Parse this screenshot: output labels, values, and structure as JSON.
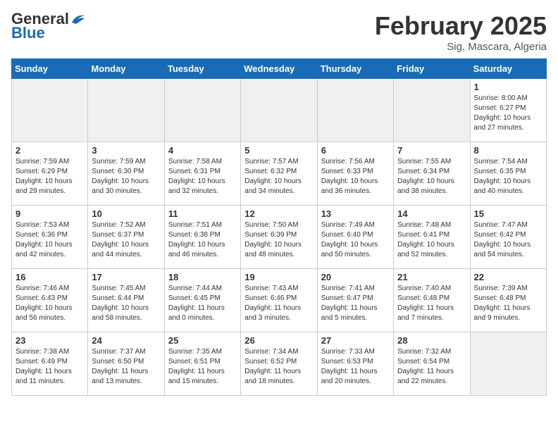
{
  "header": {
    "logo_line1": "General",
    "logo_line2": "Blue",
    "month": "February 2025",
    "location": "Sig, Mascara, Algeria"
  },
  "weekdays": [
    "Sunday",
    "Monday",
    "Tuesday",
    "Wednesday",
    "Thursday",
    "Friday",
    "Saturday"
  ],
  "weeks": [
    [
      {
        "day": "",
        "info": ""
      },
      {
        "day": "",
        "info": ""
      },
      {
        "day": "",
        "info": ""
      },
      {
        "day": "",
        "info": ""
      },
      {
        "day": "",
        "info": ""
      },
      {
        "day": "",
        "info": ""
      },
      {
        "day": "1",
        "info": "Sunrise: 8:00 AM\nSunset: 6:27 PM\nDaylight: 10 hours and 27 minutes."
      }
    ],
    [
      {
        "day": "2",
        "info": "Sunrise: 7:59 AM\nSunset: 6:29 PM\nDaylight: 10 hours and 29 minutes."
      },
      {
        "day": "3",
        "info": "Sunrise: 7:59 AM\nSunset: 6:30 PM\nDaylight: 10 hours and 30 minutes."
      },
      {
        "day": "4",
        "info": "Sunrise: 7:58 AM\nSunset: 6:31 PM\nDaylight: 10 hours and 32 minutes."
      },
      {
        "day": "5",
        "info": "Sunrise: 7:57 AM\nSunset: 6:32 PM\nDaylight: 10 hours and 34 minutes."
      },
      {
        "day": "6",
        "info": "Sunrise: 7:56 AM\nSunset: 6:33 PM\nDaylight: 10 hours and 36 minutes."
      },
      {
        "day": "7",
        "info": "Sunrise: 7:55 AM\nSunset: 6:34 PM\nDaylight: 10 hours and 38 minutes."
      },
      {
        "day": "8",
        "info": "Sunrise: 7:54 AM\nSunset: 6:35 PM\nDaylight: 10 hours and 40 minutes."
      }
    ],
    [
      {
        "day": "9",
        "info": "Sunrise: 7:53 AM\nSunset: 6:36 PM\nDaylight: 10 hours and 42 minutes."
      },
      {
        "day": "10",
        "info": "Sunrise: 7:52 AM\nSunset: 6:37 PM\nDaylight: 10 hours and 44 minutes."
      },
      {
        "day": "11",
        "info": "Sunrise: 7:51 AM\nSunset: 6:38 PM\nDaylight: 10 hours and 46 minutes."
      },
      {
        "day": "12",
        "info": "Sunrise: 7:50 AM\nSunset: 6:39 PM\nDaylight: 10 hours and 48 minutes."
      },
      {
        "day": "13",
        "info": "Sunrise: 7:49 AM\nSunset: 6:40 PM\nDaylight: 10 hours and 50 minutes."
      },
      {
        "day": "14",
        "info": "Sunrise: 7:48 AM\nSunset: 6:41 PM\nDaylight: 10 hours and 52 minutes."
      },
      {
        "day": "15",
        "info": "Sunrise: 7:47 AM\nSunset: 6:42 PM\nDaylight: 10 hours and 54 minutes."
      }
    ],
    [
      {
        "day": "16",
        "info": "Sunrise: 7:46 AM\nSunset: 6:43 PM\nDaylight: 10 hours and 56 minutes."
      },
      {
        "day": "17",
        "info": "Sunrise: 7:45 AM\nSunset: 6:44 PM\nDaylight: 10 hours and 58 minutes."
      },
      {
        "day": "18",
        "info": "Sunrise: 7:44 AM\nSunset: 6:45 PM\nDaylight: 11 hours and 0 minutes."
      },
      {
        "day": "19",
        "info": "Sunrise: 7:43 AM\nSunset: 6:46 PM\nDaylight: 11 hours and 3 minutes."
      },
      {
        "day": "20",
        "info": "Sunrise: 7:41 AM\nSunset: 6:47 PM\nDaylight: 11 hours and 5 minutes."
      },
      {
        "day": "21",
        "info": "Sunrise: 7:40 AM\nSunset: 6:48 PM\nDaylight: 11 hours and 7 minutes."
      },
      {
        "day": "22",
        "info": "Sunrise: 7:39 AM\nSunset: 6:48 PM\nDaylight: 11 hours and 9 minutes."
      }
    ],
    [
      {
        "day": "23",
        "info": "Sunrise: 7:38 AM\nSunset: 6:49 PM\nDaylight: 11 hours and 11 minutes."
      },
      {
        "day": "24",
        "info": "Sunrise: 7:37 AM\nSunset: 6:50 PM\nDaylight: 11 hours and 13 minutes."
      },
      {
        "day": "25",
        "info": "Sunrise: 7:35 AM\nSunset: 6:51 PM\nDaylight: 11 hours and 15 minutes."
      },
      {
        "day": "26",
        "info": "Sunrise: 7:34 AM\nSunset: 6:52 PM\nDaylight: 11 hours and 18 minutes."
      },
      {
        "day": "27",
        "info": "Sunrise: 7:33 AM\nSunset: 6:53 PM\nDaylight: 11 hours and 20 minutes."
      },
      {
        "day": "28",
        "info": "Sunrise: 7:32 AM\nSunset: 6:54 PM\nDaylight: 11 hours and 22 minutes."
      },
      {
        "day": "",
        "info": ""
      }
    ]
  ]
}
